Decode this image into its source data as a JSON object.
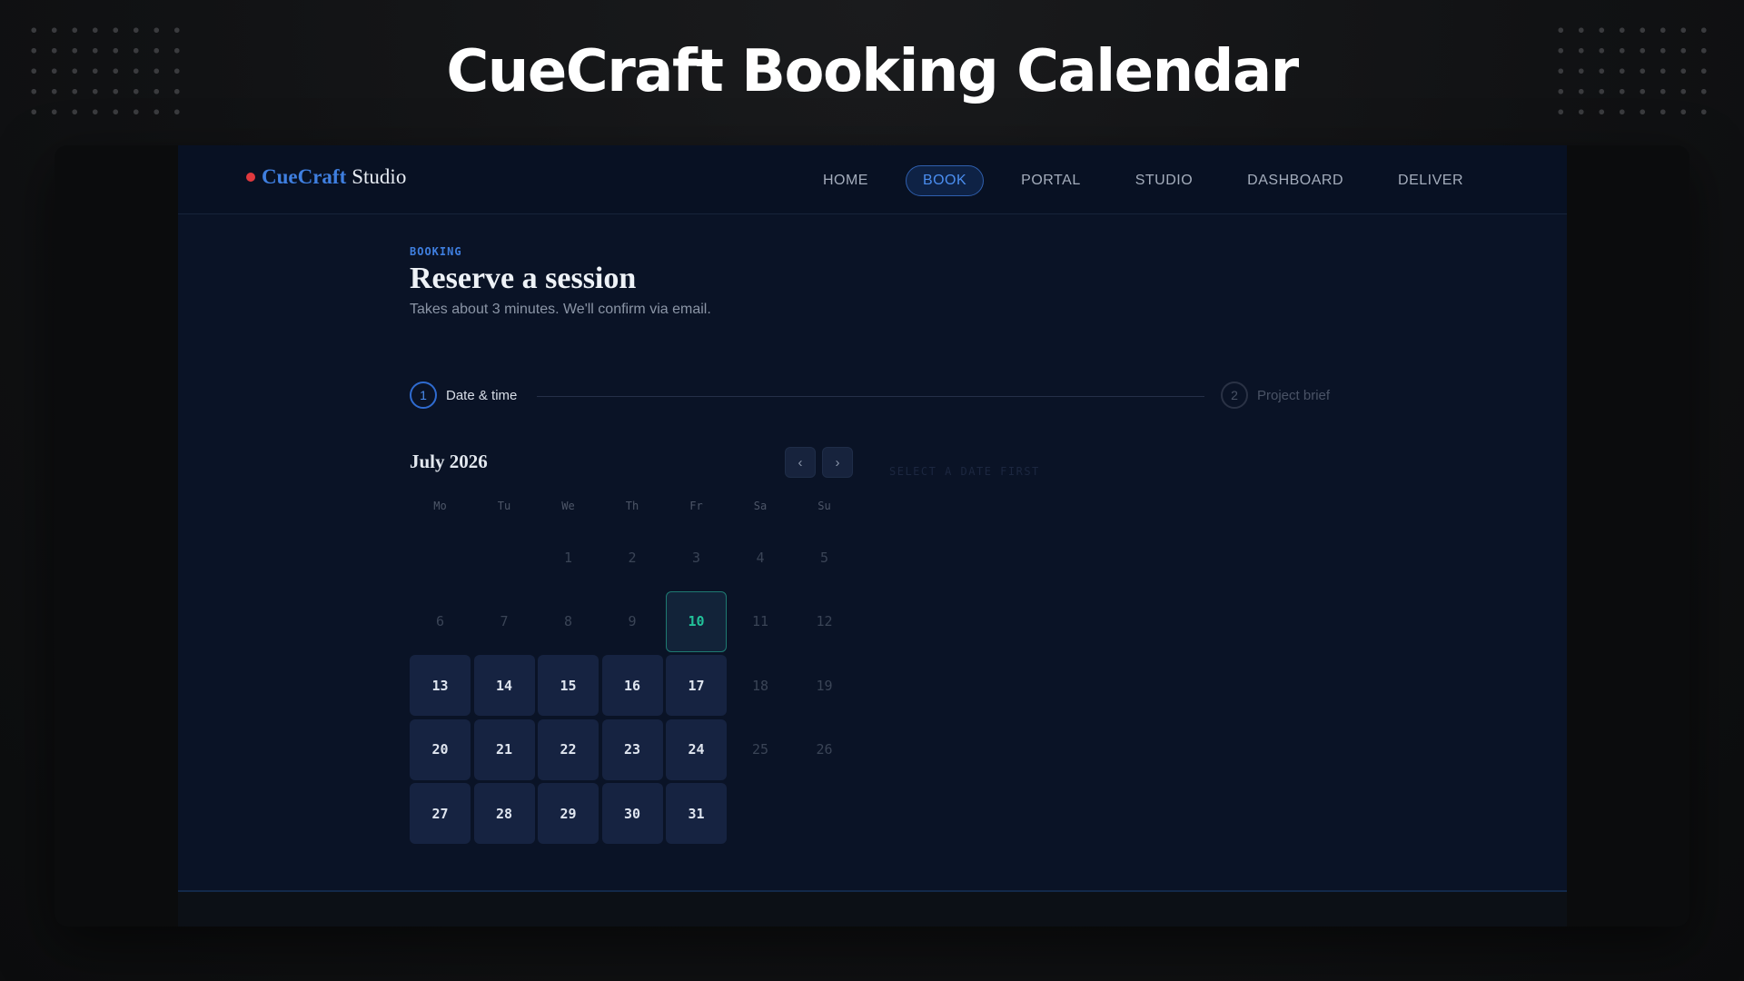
{
  "headline": "CueCraft Booking Calendar",
  "brand": {
    "accent": "CueCraft",
    "rest": "Studio"
  },
  "nav": [
    {
      "label": "HOME",
      "active": false
    },
    {
      "label": "BOOK",
      "active": true
    },
    {
      "label": "PORTAL",
      "active": false
    },
    {
      "label": "STUDIO",
      "active": false
    },
    {
      "label": "DASHBOARD",
      "active": false
    },
    {
      "label": "DELIVER",
      "active": false
    }
  ],
  "page": {
    "eyebrow": "BOOKING",
    "title": "Reserve a session",
    "subtitle": "Takes about 3 minutes. We'll confirm via email."
  },
  "steps": [
    {
      "number": "1",
      "label": "Date & time"
    },
    {
      "number": "2",
      "label": "Project brief"
    }
  ],
  "calendar": {
    "month": "July 2026",
    "prev": "‹",
    "next": "›",
    "time_hint": "SELECT A DATE FIRST",
    "weekdays": [
      "Mo",
      "Tu",
      "We",
      "Th",
      "Fr",
      "Sa",
      "Su"
    ],
    "leading_blanks": 2,
    "today": 10,
    "days": [
      {
        "d": "1",
        "s": "muted"
      },
      {
        "d": "2",
        "s": "muted"
      },
      {
        "d": "3",
        "s": "muted"
      },
      {
        "d": "4",
        "s": "muted"
      },
      {
        "d": "5",
        "s": "muted"
      },
      {
        "d": "6",
        "s": "muted"
      },
      {
        "d": "7",
        "s": "muted"
      },
      {
        "d": "8",
        "s": "muted"
      },
      {
        "d": "9",
        "s": "muted"
      },
      {
        "d": "10",
        "s": "today"
      },
      {
        "d": "11",
        "s": "muted"
      },
      {
        "d": "12",
        "s": "muted"
      },
      {
        "d": "13",
        "s": "avail"
      },
      {
        "d": "14",
        "s": "avail"
      },
      {
        "d": "15",
        "s": "avail"
      },
      {
        "d": "16",
        "s": "avail"
      },
      {
        "d": "17",
        "s": "avail"
      },
      {
        "d": "18",
        "s": "muted"
      },
      {
        "d": "19",
        "s": "muted"
      },
      {
        "d": "20",
        "s": "avail"
      },
      {
        "d": "21",
        "s": "avail"
      },
      {
        "d": "22",
        "s": "avail"
      },
      {
        "d": "23",
        "s": "avail"
      },
      {
        "d": "24",
        "s": "avail"
      },
      {
        "d": "25",
        "s": "muted"
      },
      {
        "d": "26",
        "s": "muted"
      },
      {
        "d": "27",
        "s": "avail"
      },
      {
        "d": "28",
        "s": "avail"
      },
      {
        "d": "29",
        "s": "avail"
      },
      {
        "d": "30",
        "s": "avail"
      },
      {
        "d": "31",
        "s": "avail"
      }
    ]
  },
  "colors": {
    "accent": "#3f7fe0",
    "brand_dot": "#e0393e",
    "today": "#22c29a",
    "available": "#162341",
    "background": "#0a1326"
  }
}
